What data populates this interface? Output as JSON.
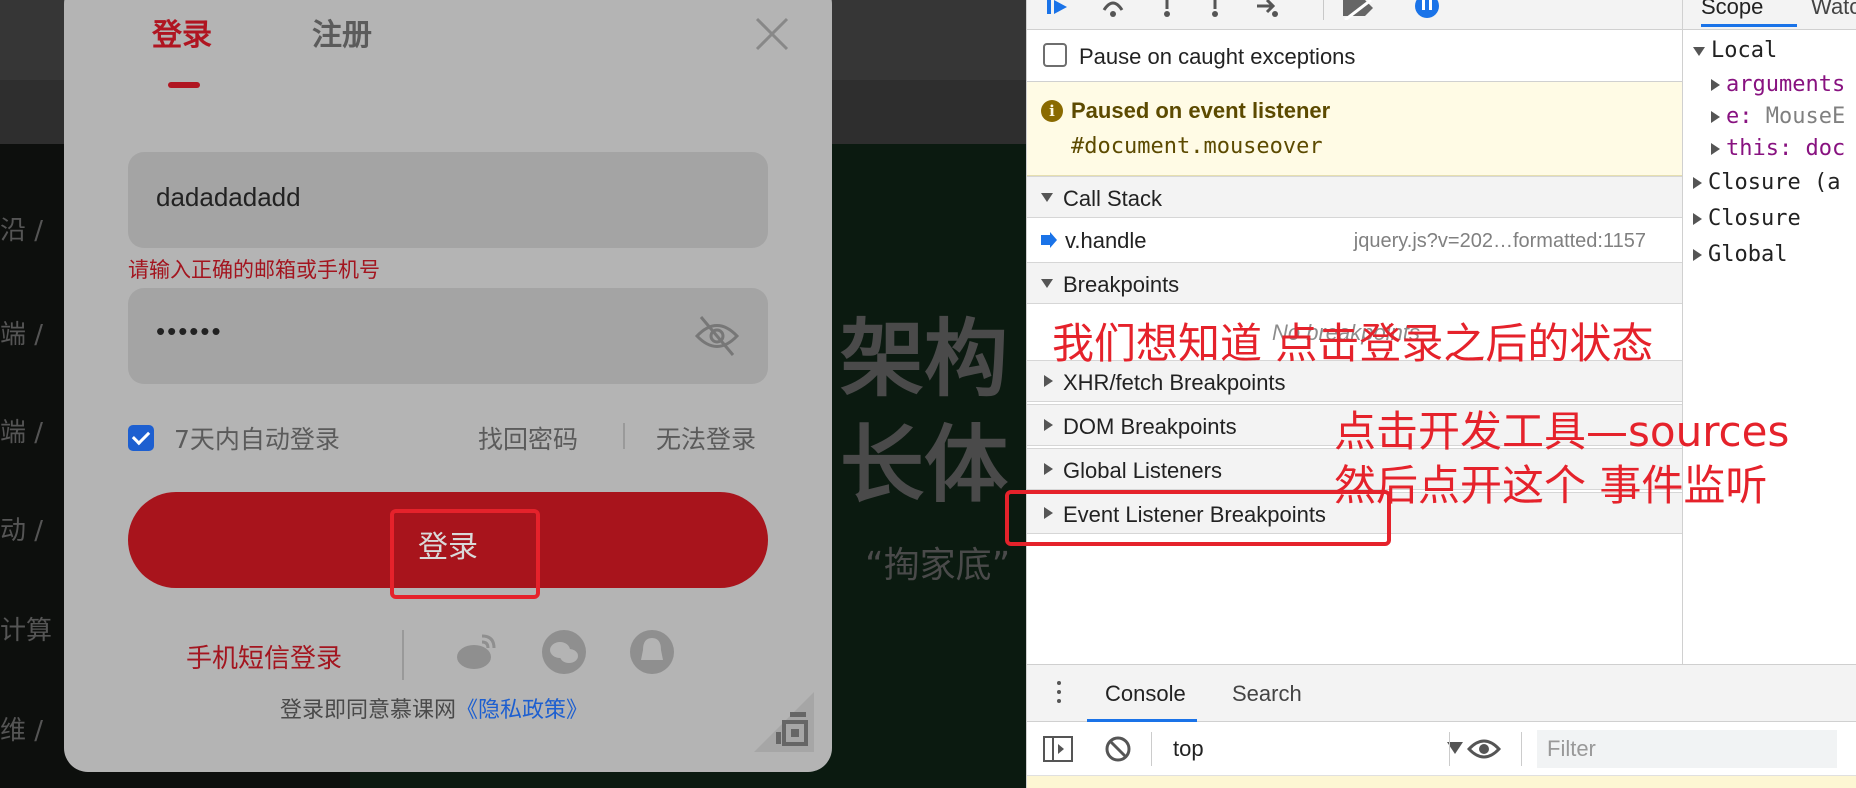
{
  "webpage": {
    "side_categories": [
      "沿 /",
      "端 /",
      "端 /",
      "动 /",
      "计算",
      "维 /"
    ],
    "banner": {
      "line1": "架构",
      "line2": "长体",
      "tagline": "“掏家底”"
    }
  },
  "login_modal": {
    "tab_login": "登录",
    "tab_register": "注册",
    "email_value": "dadadadadd",
    "error_message": "请输入正确的邮箱或手机号",
    "password_mask": "••••••",
    "remember_label": "7天内自动登录",
    "remember_checked": true,
    "forgot_password": "找回密码",
    "cannot_login": "无法登录",
    "login_button": "登录",
    "sms_login": "手机短信登录",
    "agreement_prefix": "登录即同意慕课网",
    "privacy_link": "《隐私政策》",
    "social_icons": [
      "weibo-icon",
      "wechat-icon",
      "qq-icon"
    ]
  },
  "devtools": {
    "pause_on_caught": "Pause on caught exceptions",
    "paused_title": "Paused on event listener",
    "paused_detail": "#document.mouseover",
    "call_stack_header": "Call Stack",
    "frame_name": "v.handle",
    "frame_location": "jquery.js?v=202…formatted:1157",
    "breakpoints_header": "Breakpoints",
    "no_breakpoints": "No breakpoints",
    "sections": [
      "XHR/fetch Breakpoints",
      "DOM Breakpoints",
      "Global Listeners",
      "Event Listener Breakpoints"
    ],
    "scope": {
      "tab_scope": "Scope",
      "tab_watch": "Watch",
      "local": "Local",
      "arguments": "arguments",
      "e_key": "e:",
      "e_val": "MouseE",
      "this_key": "this:",
      "this_val": "doc",
      "closure_a": "Closure (a",
      "closure": "Closure",
      "global": "Global"
    },
    "drawer": {
      "tab_console": "Console",
      "tab_search": "Search",
      "context": "top",
      "filter_placeholder": "Filter"
    }
  },
  "annotations": {
    "line1": "我们想知道 点击登录之后的状态",
    "line2": "点击开发工具—sources",
    "line3": "然后点开这个 事件监听"
  },
  "colors": {
    "annotation_red": "#e5222b",
    "brand_red": "#a8141c",
    "devtools_blue": "#1a73e8"
  }
}
